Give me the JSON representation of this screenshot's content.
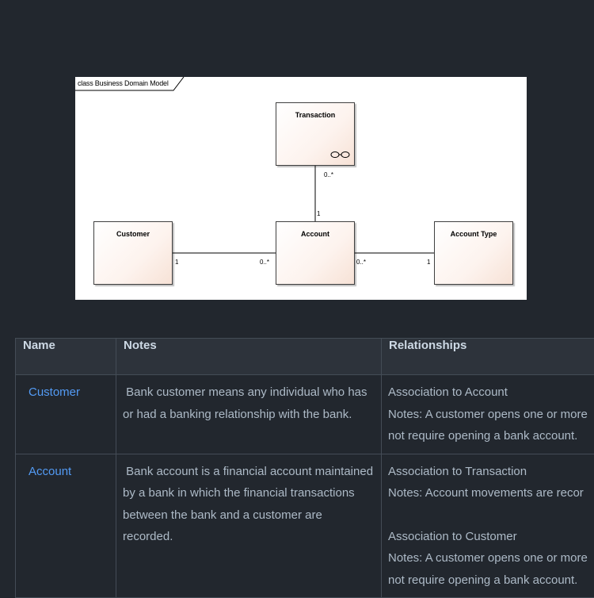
{
  "diagram": {
    "frame_title": "class Business Domain Model",
    "classes": {
      "transaction": "Transaction",
      "customer": "Customer",
      "account": "Account",
      "account_type": "Account Type"
    },
    "multiplicities": {
      "transaction_account_top": "0..*",
      "transaction_account_bottom": "1",
      "customer_side": "1",
      "account_left": "0..*",
      "account_right": "0..*",
      "account_type_side": "1"
    },
    "line_color": "#000000",
    "class_fill": "#fdf3ee"
  },
  "table": {
    "headers": [
      "Name",
      "Notes",
      "Relationships"
    ],
    "rows": [
      {
        "name": "Customer",
        "notes": " Bank customer means any individual who has or had a banking relationship with the bank.",
        "relationships": [
          {
            "title": "Association to Account",
            "line1": "Notes: A customer opens one or more",
            "line2": "not require opening a bank account."
          }
        ]
      },
      {
        "name": "Account",
        "notes": " Bank account is a financial account maintained by a bank in which the financial transactions between the bank and a customer are recorded.",
        "relationships": [
          {
            "title": "Association to Transaction",
            "line1": "Notes: Account movements are recor"
          },
          {
            "title": "Association to Customer",
            "line1": "Notes: A customer opens one or more",
            "line2": "not require opening a bank account."
          }
        ]
      }
    ]
  },
  "colors": {
    "page_bg": "#22272e",
    "header_bg": "#2d333b",
    "link": "#539bf5",
    "text": "#adbac7",
    "border": "#444c56"
  }
}
